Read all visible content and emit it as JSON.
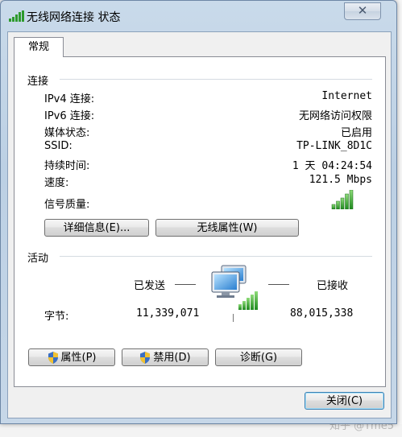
{
  "window": {
    "title": "无线网络连接 状态",
    "close_glyph": "✕"
  },
  "tabs": [
    {
      "label": "常规",
      "selected": true
    }
  ],
  "connection": {
    "section_title": "连接",
    "rows": [
      {
        "label": "IPv4 连接:",
        "value": "Internet"
      },
      {
        "label": "IPv6 连接:",
        "value": "无网络访问权限"
      },
      {
        "label": "媒体状态:",
        "value": "已启用"
      },
      {
        "label": "SSID:",
        "value": "TP-LINK_8D1C"
      },
      {
        "label": "持续时间:",
        "value": "1 天 04:24:54"
      },
      {
        "label": "速度:",
        "value": "121.5 Mbps"
      }
    ],
    "signal_label": "信号质量:",
    "signal_bars_active": 5,
    "signal_bars_total": 5,
    "details_button": "详细信息(E)...",
    "wireless_props_button": "无线属性(W)"
  },
  "activity": {
    "section_title": "活动",
    "sent_label": "已发送",
    "received_label": "已接收",
    "bytes_label": "字节:",
    "bytes_sent": "11,339,071",
    "bytes_received": "88,015,338",
    "network_icon": "network-computers-icon"
  },
  "actions": {
    "properties_button": "属性(P)",
    "disable_button": "禁用(D)",
    "diagnose_button": "诊断(G)"
  },
  "footer": {
    "close_button": "关闭(C)"
  },
  "watermark": "知乎 @Tme5",
  "colors": {
    "signal_green": "#3aa53a",
    "title_bar": "#c9daea"
  }
}
